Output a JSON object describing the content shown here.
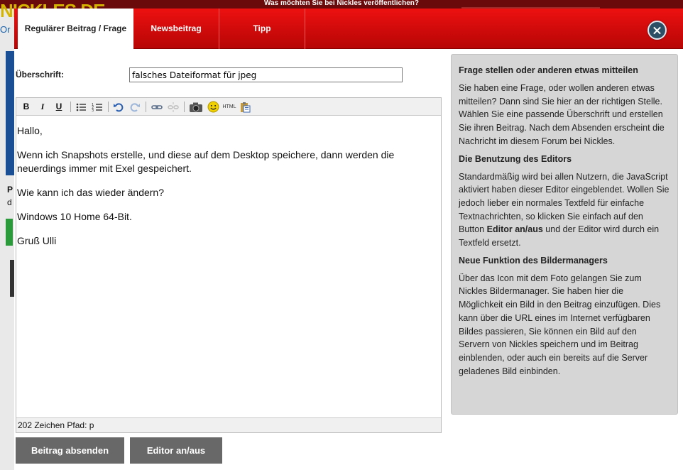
{
  "background": {
    "logo": "NICKLES.DE",
    "logo_sub": "Or",
    "letter1": "P",
    "letter2": "d",
    "banner": "Was möchten Sie bei Nickles veröffentlichen?"
  },
  "tabs": [
    {
      "label": "Regulärer Beitrag / Frage"
    },
    {
      "label": "Newsbeitrag"
    },
    {
      "label": "Tipp"
    }
  ],
  "form": {
    "heading_label": "Überschrift:",
    "heading_value": "falsches Dateiformat für jpeg"
  },
  "toolbar": {
    "bold": "B",
    "italic": "I",
    "underline": "U",
    "html": "HTML"
  },
  "editor": {
    "paragraphs": [
      "Hallo,",
      "Wenn ich Snapshots erstelle, und diese auf dem Desktop speichere, dann werden die neuerdings immer mit Exel gespeichert.",
      "Wie kann ich das wieder ändern?",
      "Windows 10 Home 64-Bit.",
      "Gruß Ulli"
    ],
    "status": "202 Zeichen Pfad: p"
  },
  "buttons": {
    "submit": "Beitrag absenden",
    "editor_toggle": "Editor an/aus"
  },
  "info": {
    "h1": "Frage stellen oder anderen etwas mitteilen",
    "p1": "Sie haben eine Frage, oder wollen anderen etwas mitteilen? Dann sind Sie hier an der richtigen Stelle. Wählen Sie eine passende Überschrift und erstellen Sie ihren Beitrag. Nach dem Absenden erscheint die Nachricht im diesem Forum bei Nickles.",
    "h2": "Die Benutzung des Editors",
    "p2_a": "Standardmäßig wird bei allen Nutzern, die JavaScript aktiviert haben dieser Editor eingeblendet. Wollen Sie jedoch lieber ein normales Textfeld für einfache Textnachrichten, so klicken Sie einfach auf den Button ",
    "p2_b": "Editor an/aus",
    "p2_c": " und der Editor wird durch ein Textfeld ersetzt.",
    "h3": "Neue Funktion des Bildermanagers",
    "p3": "Über das Icon mit dem Foto gelangen Sie zum Nickles Bildermanager. Sie haben hier die Möglichkeit ein Bild in den Beitrag einzufügen. Dies kann über die URL eines im Internet verfügbaren Bildes passieren, Sie können ein Bild auf den Servern von Nickles speichern und im Beitrag einblenden, oder auch ein bereits auf die Server geladenes Bild einbinden."
  },
  "colors": {
    "tab_red": "#cf0a0a",
    "close_bg": "#2d4f66",
    "button_gray": "#686868",
    "info_bg": "#d6d6d6"
  }
}
